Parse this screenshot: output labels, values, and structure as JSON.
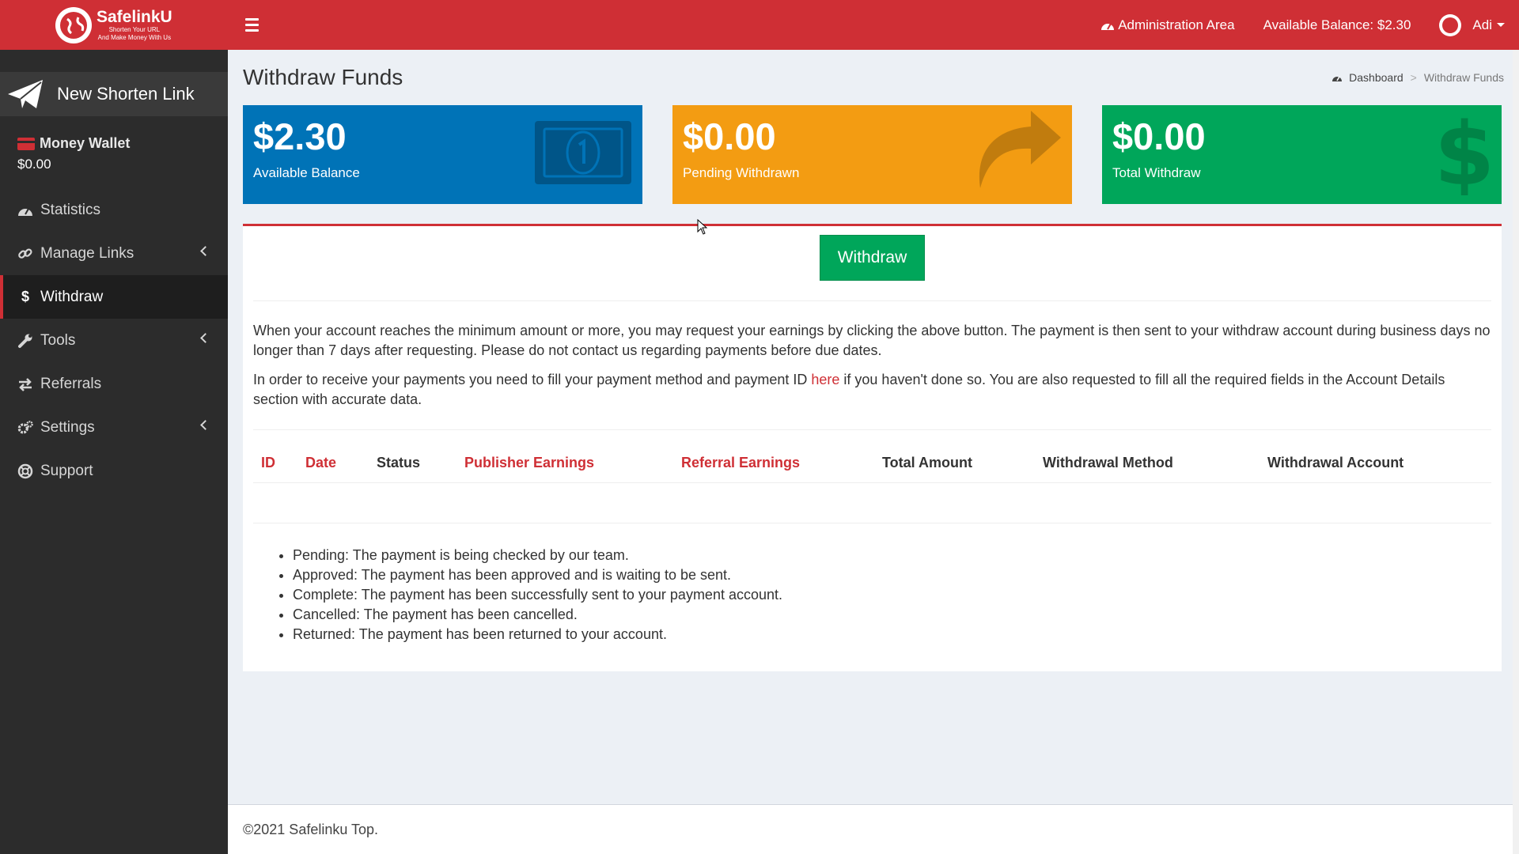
{
  "header": {
    "brand": "SafelinkU",
    "tagline_1": "Shorten Your URL",
    "tagline_2": "And Make Money With Us",
    "admin_label": "Administration Area",
    "balance_label": "Available Balance: $2.30",
    "user_name": "Adi"
  },
  "sidebar": {
    "new_link_label": "New Shorten Link",
    "wallet_title": "Money Wallet",
    "wallet_amount": "$0.00",
    "items": [
      {
        "label": "Statistics",
        "icon": "dashboard-icon"
      },
      {
        "label": "Manage Links",
        "icon": "link-icon"
      },
      {
        "label": "Withdraw",
        "icon": "dollar-icon"
      },
      {
        "label": "Tools",
        "icon": "wrench-icon"
      },
      {
        "label": "Referrals",
        "icon": "exchange-icon"
      },
      {
        "label": "Settings",
        "icon": "gears-icon"
      },
      {
        "label": "Support",
        "icon": "life-ring-icon"
      }
    ]
  },
  "page": {
    "title": "Withdraw Funds",
    "breadcrumb_home": "Dashboard",
    "breadcrumb_current": "Withdraw Funds"
  },
  "boxes": {
    "available": {
      "value": "$2.30",
      "label": "Available Balance"
    },
    "pending": {
      "value": "$0.00",
      "label": "Pending Withdrawn"
    },
    "total": {
      "value": "$0.00",
      "label": "Total Withdraw"
    }
  },
  "panel": {
    "withdraw_button": "Withdraw",
    "para1": "When your account reaches the minimum amount or more, you may request your earnings by clicking the above button. The payment is then sent to your withdraw account during business days no longer than 7 days after requesting. Please do not contact us regarding payments before due dates.",
    "para2_before": "In order to receive your payments you need to fill your payment method and payment ID ",
    "para2_link": "here",
    "para2_after": " if you haven't done so. You are also requested to fill all the required fields in the Account Details section with accurate data.",
    "columns": [
      "ID",
      "Date",
      "Status",
      "Publisher Earnings",
      "Referral Earnings",
      "Total Amount",
      "Withdrawal Method",
      "Withdrawal Account"
    ],
    "legend": [
      "Pending: The payment is being checked by our team.",
      "Approved: The payment has been approved and is waiting to be sent.",
      "Complete: The payment has been successfully sent to your payment account.",
      "Cancelled: The payment has been cancelled.",
      "Returned: The payment has been returned to your account."
    ]
  },
  "footer": {
    "text": "©2021 Safelinku Top."
  },
  "colors": {
    "brand_red": "#cf2f35",
    "blue": "#0073b7",
    "orange": "#f39c12",
    "green": "#00a65a",
    "sidebar_bg": "#2c2c2c"
  }
}
